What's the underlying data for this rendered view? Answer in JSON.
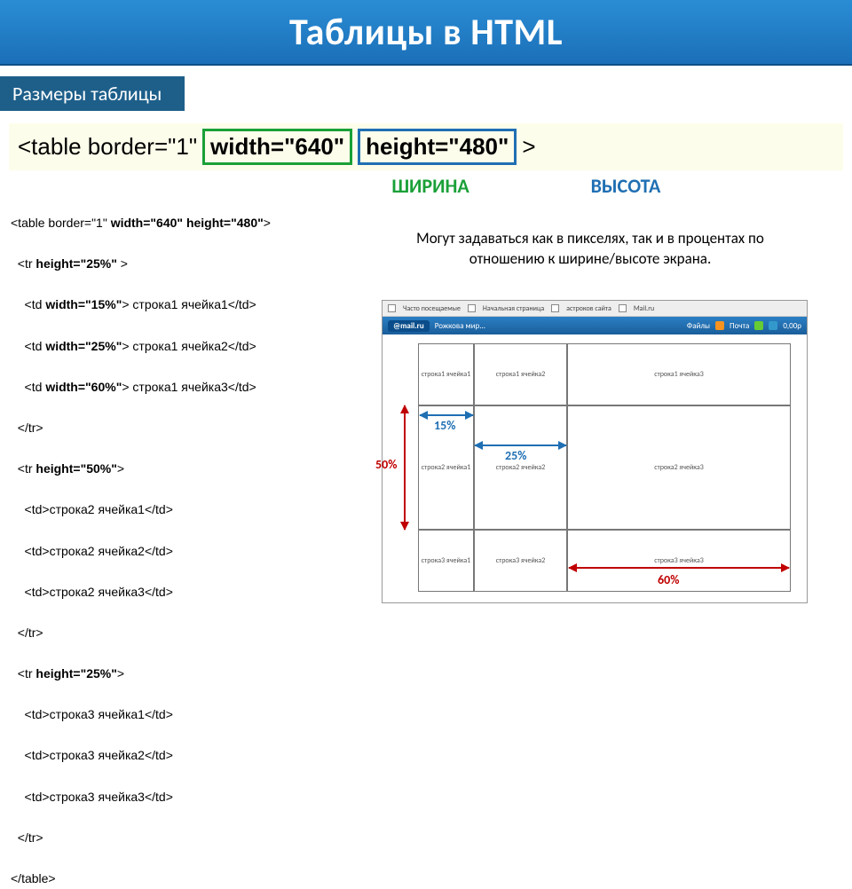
{
  "title": "Таблицы в HTML",
  "subtitle": "Размеры таблицы",
  "syntax": {
    "prefix": "<table border=\"1\"",
    "width_attr": "width=\"640\"",
    "height_attr": "height=\"480\"",
    "suffix": ">"
  },
  "labels": {
    "width": "ШИРИНА",
    "height": "ВЫСОТА"
  },
  "desc": "Могут задаваться как в пикселях, так и в процентах по отношению к ширине/высоте экрана.",
  "code": "<table border=\"1\" width=\"640\" height=\"480\">\n\n  <tr height=\"25%\" >\n\n    <td width=\"15%\"> строка1 ячейка1</td>\n\n    <td width=\"25%\"> строка1 ячейка2</td>\n\n    <td width=\"60%\"> строка1 ячейка3</td>\n\n  </tr>\n\n  <tr height=\"50%\">\n\n    <td>строка2 ячейка1</td>\n\n    <td>строка2 ячейка2</td>\n\n    <td>строка2 ячейка3</td>\n\n  </tr>\n\n  <tr height=\"25%\">\n\n    <td>строка3 ячейка1</td>\n\n    <td>строка3 ячейка2</td>\n\n    <td>строка3 ячейка3</td>\n\n  </tr>\n\n</table>",
  "toolbar1": {
    "a": "Часто посещаемые",
    "b": "Начальная страница",
    "c": "астроков сайта",
    "d": "Mail.ru"
  },
  "toolbar2": {
    "logo": "@mail.ru",
    "a": "Рожкова мир...",
    "b": "Файлы",
    "c": "Почта",
    "d": "0,00р"
  },
  "cells": {
    "c11": "строка1 ячейка1",
    "c12": "строка1 ячейка2",
    "c13": "строка1 ячейка3",
    "c21": "строка2 ячейка1",
    "c22": "строка2 ячейка2",
    "c23": "строка2 ячейка3",
    "c31": "строка3 ячейка1",
    "c32": "строка3 ячейка2",
    "c33": "строка3 ячейка3"
  },
  "pct": {
    "p15": "15%",
    "p25": "25%",
    "p50": "50%",
    "p60": "60%"
  }
}
